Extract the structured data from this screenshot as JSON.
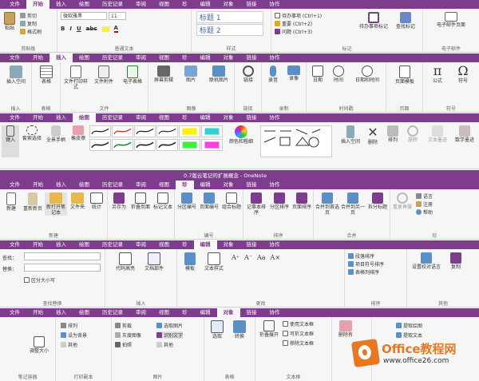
{
  "colors": {
    "accent": "#7e3d8c",
    "tab_bg": "#7e3d8c",
    "ribbon_bg": "#f6f6f6",
    "logo_orange": "#e87722"
  },
  "ribbon1": {
    "tabs": [
      "文件",
      "开始",
      "插入",
      "绘图",
      "历史记录",
      "审阅",
      "视图",
      "珍",
      "编辑",
      "对象",
      "链接",
      "协作"
    ],
    "active": 1,
    "clipboard": {
      "paste": "粘贴",
      "cut": "剪切",
      "copy": "复制",
      "format_painter": "格式刷",
      "label": "剪贴板"
    },
    "font": {
      "family": "微软雅黑",
      "size": "11",
      "label": "普通文本"
    },
    "styles": {
      "h1": "标题 1",
      "h2": "标题 2",
      "label": "样式"
    },
    "tags": {
      "items": [
        "待办事项 (Ctrl+1)",
        "重要 (Ctrl+2)",
        "问题 (Ctrl+3)"
      ],
      "todo_tag": "待办事项标记",
      "find_tags": "查找标记",
      "label": "标记"
    },
    "email": {
      "btn": "电子邮件页面",
      "label": "电子邮件"
    }
  },
  "ribbon2": {
    "tabs": [
      "文件",
      "开始",
      "插入",
      "绘图",
      "历史记录",
      "审阅",
      "视图",
      "珍",
      "编辑",
      "对象",
      "链接",
      "协作"
    ],
    "active": 2,
    "groups": [
      {
        "label": "插入",
        "btns": [
          "插入空间"
        ]
      },
      {
        "label": "表格",
        "btns": [
          "表格"
        ]
      },
      {
        "label": "文件",
        "btns": [
          "文件打印样式",
          "文件附件",
          "电子表格"
        ]
      },
      {
        "label": "图像",
        "btns": [
          "屏幕剪辑",
          "图片",
          "联机图片"
        ]
      },
      {
        "label": "链接",
        "btns": [
          "链接"
        ]
      },
      {
        "label": "录制",
        "btns": [
          "录音",
          "录像"
        ]
      },
      {
        "label": "时间戳",
        "btns": [
          "日期",
          "时间",
          "日期和时间"
        ]
      },
      {
        "label": "页面",
        "btns": [
          "页面模板"
        ]
      },
      {
        "label": "符号",
        "btns": [
          "公式",
          "符号"
        ]
      }
    ]
  },
  "ribbon3": {
    "tabs": [
      "文件",
      "开始",
      "插入",
      "绘图",
      "历史记录",
      "审阅",
      "视图",
      "珍",
      "编辑",
      "对象",
      "链接",
      "协作"
    ],
    "active": 3,
    "tools": [
      "键入",
      "套索选择",
      "全景手柄",
      "橡皮擦"
    ],
    "color": "颜色和粗细",
    "actions": [
      "插入空间",
      "删除",
      "排列",
      "旋转",
      "文本墨迹",
      "数学墨迹"
    ]
  },
  "ribbon4": {
    "title": "0.7版云笔记的扩展概念 - OneNote",
    "tabs": [
      "文件",
      "开始",
      "插入",
      "绘图",
      "历史记录",
      "审阅",
      "视图",
      "珍",
      "编辑",
      "对象",
      "链接",
      "协作"
    ],
    "active": 7,
    "groups": [
      {
        "label": "新建",
        "btns": [
          "新建",
          "重新新页",
          "新打开笔记本",
          "文件夹",
          "统计"
        ]
      },
      {
        "label": "",
        "btns": [
          "另存为",
          "折叠页面",
          "标记文本"
        ]
      },
      {
        "label": "编号",
        "btns": [
          "分区编号",
          "页面编号",
          "组合标题"
        ]
      },
      {
        "label": "排序",
        "btns": [
          "记事本排序",
          "分区排序",
          "页面排序"
        ]
      },
      {
        "label": "合并",
        "btns": [
          "合并到首选页",
          "合并到另一页",
          "拆分标题"
        ]
      },
      {
        "label": "珍",
        "btns": [
          "重复再做",
          "语言",
          "注册",
          "帮助"
        ]
      }
    ]
  },
  "ribbon5": {
    "tabs": [
      "文件",
      "开始",
      "插入",
      "绘图",
      "历史记录",
      "审阅",
      "视图",
      "珍",
      "编辑",
      "对象",
      "链接",
      "协作"
    ],
    "active": 8,
    "find": "查找：",
    "replace": "替换：",
    "match_case": "区分大小写",
    "groups": [
      {
        "label": "查找替换",
        "btns": []
      },
      {
        "label": "插入",
        "btns": [
          "代码高亮",
          "文档部件"
        ]
      },
      {
        "label": "更改",
        "btns": [
          "模板",
          "文本样式"
        ]
      },
      {
        "label": "排序",
        "btns": [
          "段落排序",
          "项目符号排序",
          "表格列排序"
        ]
      },
      {
        "label": "其他",
        "btns": [
          "设置校对语言",
          "复制"
        ]
      }
    ]
  },
  "ribbon6": {
    "tabs": [
      "文件",
      "开始",
      "插入",
      "绘图",
      "历史记录",
      "审阅",
      "视图",
      "珍",
      "编辑",
      "对象",
      "链接",
      "协作"
    ],
    "active": 9,
    "groups": [
      {
        "label": "笔记容器",
        "btns": [
          "调整大小"
        ]
      },
      {
        "label": "打印副本",
        "btns": [
          "排列",
          "设为背景",
          "其他"
        ]
      },
      {
        "label": "图片",
        "btns": [
          "剪裁",
          "灰度图像",
          "拍照",
          "选取图片",
          "识别文字",
          "其他"
        ]
      },
      {
        "label": "表格",
        "btns": [
          "选取",
          "转换"
        ]
      },
      {
        "label": "文本框",
        "btns": [
          "折叠展开",
          "使用文本框",
          "可折文本框",
          "移除文本框"
        ]
      },
      {
        "label": "",
        "btns": [
          "删除有"
        ]
      },
      {
        "label": "",
        "btns": [
          "提取绘图",
          "提取文本"
        ]
      }
    ]
  },
  "watermark": {
    "brand": "Office教程网",
    "url": "www.office26.com"
  }
}
